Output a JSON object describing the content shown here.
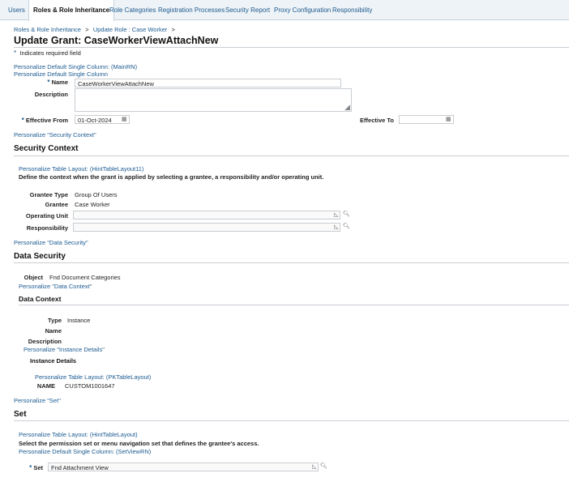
{
  "tabs": [
    "Users",
    "Roles & Role Inheritance",
    "Role Categories",
    "Registration Processes",
    "Security Report",
    "Proxy Configuration",
    "Responsibility"
  ],
  "breadcrumb": {
    "item1": "Roles & Role Inheritance",
    "sep1": ">",
    "item2": "Update Role : Case Worker",
    "sep2": ">"
  },
  "page_title": "Update Grant: CaseWorkerViewAttachNew",
  "required_note": {
    "star": "*",
    "text": "Indicates required field"
  },
  "personalize": {
    "main_rn": "Personalize Default Single Column: (MainRN)",
    "default_single": "Personalize Default Single Column",
    "security_context": "Personalize \"Security Context\"",
    "hint_table11": "Personalize Table Layout: (HintTableLayout11)",
    "data_security": "Personalize \"Data Security\"",
    "data_context": "Personalize \"Data Context\"",
    "instance_details": "Personalize \"Instance Details\"",
    "pk_table": "Personalize Table Layout: (PKTableLayout)",
    "set": "Personalize \"Set\"",
    "hint_table": "Personalize Table Layout: (HintTableLayout)",
    "set_view_rn": "Personalize Default Single Column: (SetViewRN)"
  },
  "form": {
    "name_label": "Name",
    "name_value": "CaseWorkerViewAttachNew",
    "description_label": "Description",
    "effective_from_label": "Effective From",
    "effective_from_value": "01-Oct-2024",
    "effective_to_label": "Effective To",
    "effective_to_value": ""
  },
  "security_context": {
    "heading": "Security Context",
    "instructions": "Define the context when the grant is applied by selecting a grantee, a responsibility and/or operating unit.",
    "grantee_type_label": "Grantee Type",
    "grantee_type_value": "Group Of Users",
    "grantee_label": "Grantee",
    "grantee_value": "Case Worker",
    "operating_unit_label": "Operating Unit",
    "responsibility_label": "Responsibility"
  },
  "data_security": {
    "heading": "Data Security",
    "object_label": "Object",
    "object_value": "Fnd Document Categories"
  },
  "data_context": {
    "heading": "Data Context",
    "type_label": "Type",
    "type_value": "Instance",
    "name_label": "Name",
    "description_label": "Description",
    "instance_details_heading": "Instance Details",
    "pk_label": "NAME",
    "pk_value": "CUSTOM1001647"
  },
  "set_section": {
    "heading": "Set",
    "instructions": "Select the permission set or menu navigation set that defines the grantee's access.",
    "set_label": "Set",
    "set_value": "Fnd Attachment View"
  },
  "icons": {
    "calendar": "calendar-icon",
    "search": "search-icon",
    "clear": "clear-icon",
    "resize": "resize-grip-icon"
  }
}
